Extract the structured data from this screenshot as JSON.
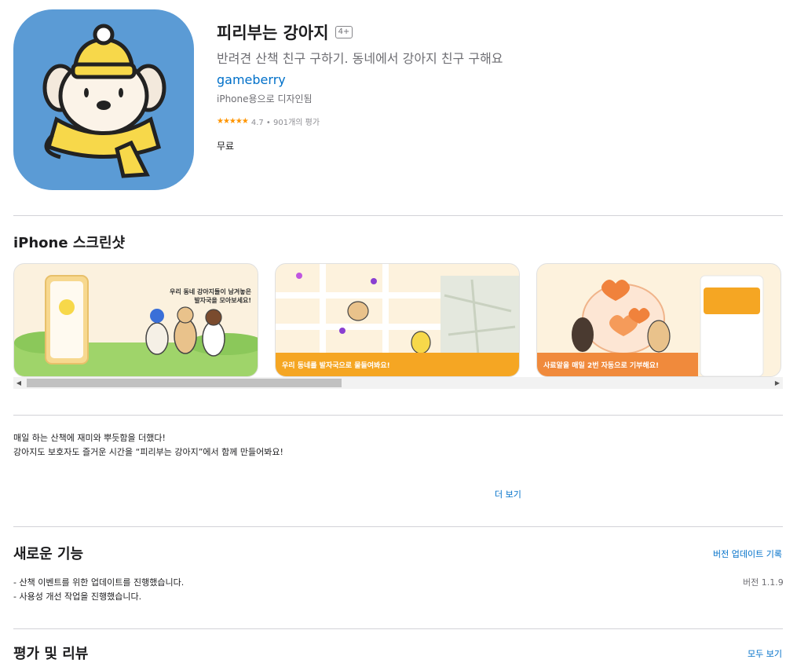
{
  "app": {
    "title": "피리부는 강아지",
    "age_rating": "4+",
    "subtitle": "반려견 산책 친구 구하기. 동네에서 강아지 친구 구해요",
    "developer": "gameberry",
    "designed_for": "iPhone용으로 디자인됨",
    "stars": "★★★★★",
    "rating_text": "4.7 • 901개의 평가",
    "price": "무료"
  },
  "screenshots": {
    "title": "iPhone 스크린샷",
    "shot1_caption": "우리 동네 강아지들이 남겨놓은 발자국을 모아보세요!",
    "shot2_caption": "우리 동네를 발자국으로 물들여봐요!",
    "shot3_caption": "사료알을 매일 2번 자동으로 기부해요!"
  },
  "description": {
    "line1": "매일 하는 산책에 재미와 뿌듯함을 더했다!",
    "line2": "강아지도 보호자도 즐거운 시간을 “피리부는 강아지”에서 함께 만들어봐요!",
    "more": "더 보기"
  },
  "whats_new": {
    "title": "새로운 기능",
    "history_link": "버전 업데이트 기록",
    "version": "버전 1.1.9",
    "note1": "- 산책 이벤트를 위한 업데이트를 진행했습니다.",
    "note2": "- 사용성 개선 작업을 진행했습니다."
  },
  "reviews": {
    "title": "평가 및 리뷰",
    "see_all": "모두 보기"
  },
  "colors": {
    "accent": "#0070c9",
    "icon_bg": "#5b9bd5",
    "scarf": "#f7d84a",
    "banner_orange": "#f5a623",
    "banner_deep": "#f08a3c"
  }
}
